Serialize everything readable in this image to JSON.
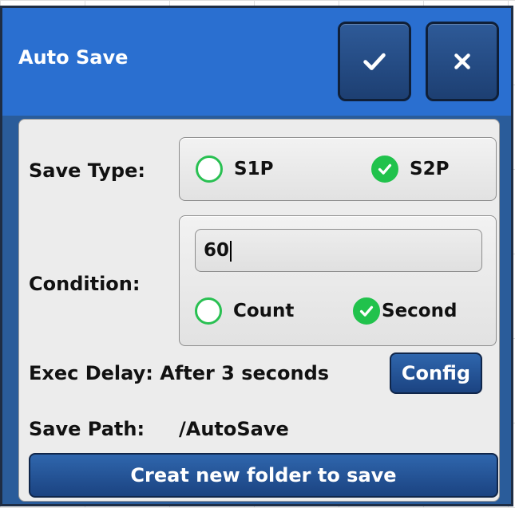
{
  "dialog": {
    "title": "Auto Save",
    "confirm_icon": "check-icon",
    "close_icon": "close-icon"
  },
  "save_type": {
    "label": "Save Type:",
    "options": [
      {
        "label": "S1P",
        "checked": false
      },
      {
        "label": "S2P",
        "checked": true
      }
    ]
  },
  "condition": {
    "label": "Condition:",
    "value": "60",
    "options": [
      {
        "label": "Count",
        "checked": false
      },
      {
        "label": "Second",
        "checked": true
      }
    ]
  },
  "exec_delay": {
    "text": "Exec Delay: After 3 seconds",
    "button_label": "Config"
  },
  "save_path": {
    "label": "Save Path:",
    "value": "/AutoSave",
    "button_label": "Creat new folder to save"
  },
  "colors": {
    "title_bar": "#2a6fd0",
    "radio_green": "#21c24c",
    "button_blue": "#1b4381"
  }
}
